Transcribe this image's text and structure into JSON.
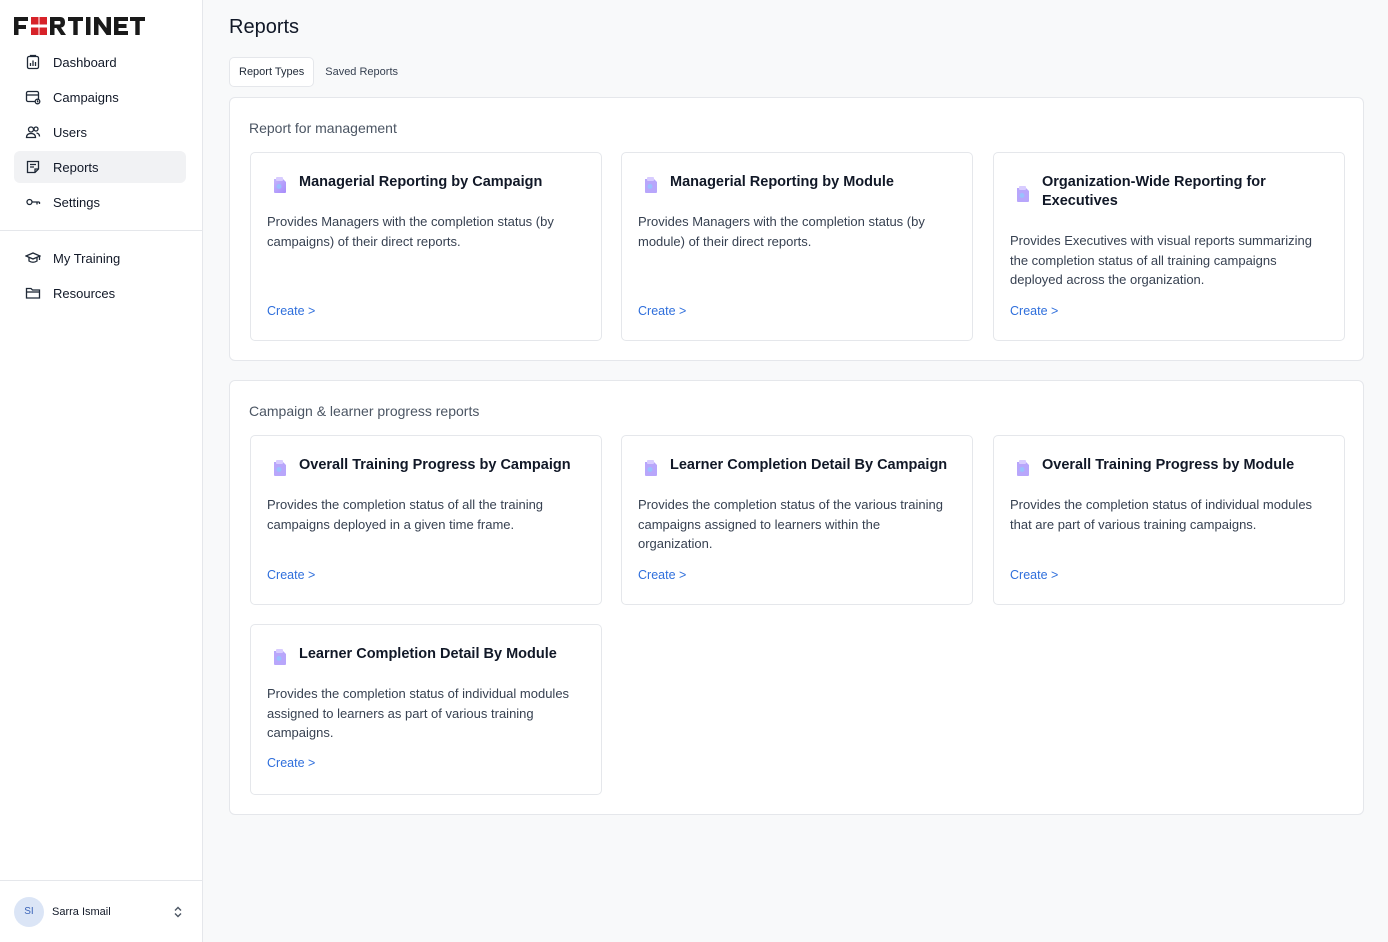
{
  "brand": {
    "name": "FORTINET",
    "accent": "#d72229"
  },
  "sidebar": {
    "main_items": [
      {
        "label": "Dashboard",
        "icon": "dashboard-icon"
      },
      {
        "label": "Campaigns",
        "icon": "campaigns-icon"
      },
      {
        "label": "Users",
        "icon": "users-icon"
      },
      {
        "label": "Reports",
        "icon": "reports-icon",
        "active": true
      },
      {
        "label": "Settings",
        "icon": "settings-icon"
      }
    ],
    "secondary_items": [
      {
        "label": "My Training",
        "icon": "graduation-cap-icon"
      },
      {
        "label": "Resources",
        "icon": "folder-icon"
      }
    ],
    "user": {
      "initials": "SI",
      "name": "Sarra Ismail"
    }
  },
  "page": {
    "title": "Reports",
    "tabs": [
      {
        "label": "Report Types",
        "active": true
      },
      {
        "label": "Saved Reports",
        "active": false
      }
    ]
  },
  "sections": [
    {
      "title": "Report for management",
      "cards": [
        {
          "title": "Managerial Reporting by Campaign",
          "description": "Provides Managers with the completion status (by campaigns) of their direct reports.",
          "action": "Create >"
        },
        {
          "title": "Managerial Reporting by Module",
          "description": "Provides Managers with the completion status (by module) of their direct reports.",
          "action": "Create >"
        },
        {
          "title": "Organization-Wide Reporting for Executives",
          "description": "Provides Executives with visual reports summarizing the completion status of all training campaigns deployed across the organization.",
          "action": "Create >"
        }
      ]
    },
    {
      "title": "Campaign & learner progress reports",
      "cards": [
        {
          "title": "Overall Training Progress by Campaign",
          "description": "Provides the completion status of all the training campaigns deployed in a given time frame.",
          "action": "Create >"
        },
        {
          "title": "Learner Completion Detail By Campaign",
          "description": "Provides the completion status of the various training campaigns assigned to learners within the organization.",
          "action": "Create >"
        },
        {
          "title": "Overall Training Progress by Module",
          "description": "Provides the completion status of individual modules that are part of various training campaigns.",
          "action": "Create >"
        },
        {
          "title": "Learner Completion Detail By Module",
          "description": "Provides the completion status of individual modules assigned to learners as part of various training campaigns.",
          "action": "Create >"
        }
      ]
    }
  ]
}
